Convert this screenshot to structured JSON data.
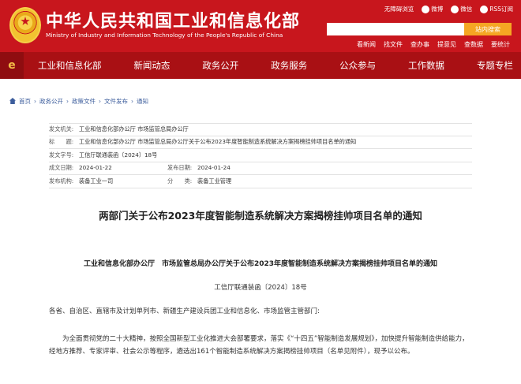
{
  "header": {
    "site_name": "中华人民共和国工业和信息化部",
    "site_name_en": "Ministry of Industry and Information Technology of the People's Republic of China",
    "top_links": [
      "无障碍浏览",
      "微博",
      "微信",
      "RSS订阅"
    ],
    "search_placeholder": "",
    "search_button": "站内搜索",
    "quick_links": [
      "看新闻",
      "找文件",
      "查办事",
      "提意见",
      "查数据",
      "要统计"
    ]
  },
  "nav": {
    "home_glyph": "e",
    "items": [
      "工业和信息化部",
      "新闻动态",
      "政务公开",
      "政务服务",
      "公众参与",
      "工作数据",
      "专题专栏"
    ]
  },
  "breadcrumb": [
    "首页",
    "政务公开",
    "政策文件",
    "文件发布",
    "通知"
  ],
  "info": {
    "issuer_label": "发文机关:",
    "issuer": "工业和信息化部办公厅 市场监管总局办公厅",
    "title_label": "标　　题:",
    "title": "工业和信息化部办公厅 市场监管总局办公厅关于公布2023年度智能制造系统解决方案揭榜挂帅项目名单的通知",
    "docno_label": "发文字号:",
    "docno": "工信厅联通装函〔2024〕18号",
    "date_label": "成文日期:",
    "date": "2024-01-22",
    "pubdate_label": "发布日期:",
    "pubdate": "2024-01-24",
    "org_label": "发布机构:",
    "org": "装备工业一司",
    "category_label": "分　　类:",
    "category": "装备工业管理"
  },
  "article": {
    "title": "两部门关于公布2023年度智能制造系统解决方案揭榜挂帅项目名单的通知",
    "subtitle": "工业和信息化部办公厅　市场监管总局办公厅关于公布2023年度智能制造系统解决方案揭榜挂帅项目名单的通知",
    "docno": "工信厅联通装函〔2024〕18号",
    "salutation": "各省、自治区、直辖市及计划单列市、新疆生产建设兵团工业和信息化、市场监管主管部门:",
    "body": "为全面贯彻党的二十大精神，按照全国新型工业化推进大会部署要求，落实《“十四五”智能制造发展规划》，加快提升智能制造供给能力，经地方推荐、专家评审、社会公示等程序，遴选出161个智能制造系统解决方案揭榜挂帅项目（名单见附件），现予以公布。"
  }
}
